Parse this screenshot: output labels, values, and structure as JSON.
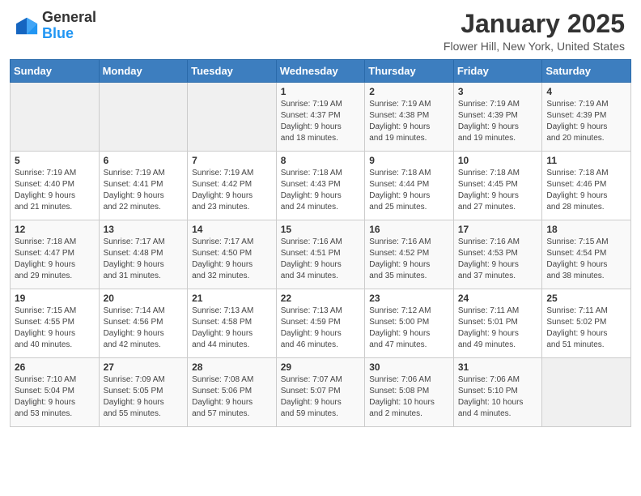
{
  "header": {
    "logo_general": "General",
    "logo_blue": "Blue",
    "title": "January 2025",
    "subtitle": "Flower Hill, New York, United States"
  },
  "weekdays": [
    "Sunday",
    "Monday",
    "Tuesday",
    "Wednesday",
    "Thursday",
    "Friday",
    "Saturday"
  ],
  "weeks": [
    [
      {
        "day": "",
        "info": ""
      },
      {
        "day": "",
        "info": ""
      },
      {
        "day": "",
        "info": ""
      },
      {
        "day": "1",
        "info": "Sunrise: 7:19 AM\nSunset: 4:37 PM\nDaylight: 9 hours\nand 18 minutes."
      },
      {
        "day": "2",
        "info": "Sunrise: 7:19 AM\nSunset: 4:38 PM\nDaylight: 9 hours\nand 19 minutes."
      },
      {
        "day": "3",
        "info": "Sunrise: 7:19 AM\nSunset: 4:39 PM\nDaylight: 9 hours\nand 19 minutes."
      },
      {
        "day": "4",
        "info": "Sunrise: 7:19 AM\nSunset: 4:39 PM\nDaylight: 9 hours\nand 20 minutes."
      }
    ],
    [
      {
        "day": "5",
        "info": "Sunrise: 7:19 AM\nSunset: 4:40 PM\nDaylight: 9 hours\nand 21 minutes."
      },
      {
        "day": "6",
        "info": "Sunrise: 7:19 AM\nSunset: 4:41 PM\nDaylight: 9 hours\nand 22 minutes."
      },
      {
        "day": "7",
        "info": "Sunrise: 7:19 AM\nSunset: 4:42 PM\nDaylight: 9 hours\nand 23 minutes."
      },
      {
        "day": "8",
        "info": "Sunrise: 7:18 AM\nSunset: 4:43 PM\nDaylight: 9 hours\nand 24 minutes."
      },
      {
        "day": "9",
        "info": "Sunrise: 7:18 AM\nSunset: 4:44 PM\nDaylight: 9 hours\nand 25 minutes."
      },
      {
        "day": "10",
        "info": "Sunrise: 7:18 AM\nSunset: 4:45 PM\nDaylight: 9 hours\nand 27 minutes."
      },
      {
        "day": "11",
        "info": "Sunrise: 7:18 AM\nSunset: 4:46 PM\nDaylight: 9 hours\nand 28 minutes."
      }
    ],
    [
      {
        "day": "12",
        "info": "Sunrise: 7:18 AM\nSunset: 4:47 PM\nDaylight: 9 hours\nand 29 minutes."
      },
      {
        "day": "13",
        "info": "Sunrise: 7:17 AM\nSunset: 4:48 PM\nDaylight: 9 hours\nand 31 minutes."
      },
      {
        "day": "14",
        "info": "Sunrise: 7:17 AM\nSunset: 4:50 PM\nDaylight: 9 hours\nand 32 minutes."
      },
      {
        "day": "15",
        "info": "Sunrise: 7:16 AM\nSunset: 4:51 PM\nDaylight: 9 hours\nand 34 minutes."
      },
      {
        "day": "16",
        "info": "Sunrise: 7:16 AM\nSunset: 4:52 PM\nDaylight: 9 hours\nand 35 minutes."
      },
      {
        "day": "17",
        "info": "Sunrise: 7:16 AM\nSunset: 4:53 PM\nDaylight: 9 hours\nand 37 minutes."
      },
      {
        "day": "18",
        "info": "Sunrise: 7:15 AM\nSunset: 4:54 PM\nDaylight: 9 hours\nand 38 minutes."
      }
    ],
    [
      {
        "day": "19",
        "info": "Sunrise: 7:15 AM\nSunset: 4:55 PM\nDaylight: 9 hours\nand 40 minutes."
      },
      {
        "day": "20",
        "info": "Sunrise: 7:14 AM\nSunset: 4:56 PM\nDaylight: 9 hours\nand 42 minutes."
      },
      {
        "day": "21",
        "info": "Sunrise: 7:13 AM\nSunset: 4:58 PM\nDaylight: 9 hours\nand 44 minutes."
      },
      {
        "day": "22",
        "info": "Sunrise: 7:13 AM\nSunset: 4:59 PM\nDaylight: 9 hours\nand 46 minutes."
      },
      {
        "day": "23",
        "info": "Sunrise: 7:12 AM\nSunset: 5:00 PM\nDaylight: 9 hours\nand 47 minutes."
      },
      {
        "day": "24",
        "info": "Sunrise: 7:11 AM\nSunset: 5:01 PM\nDaylight: 9 hours\nand 49 minutes."
      },
      {
        "day": "25",
        "info": "Sunrise: 7:11 AM\nSunset: 5:02 PM\nDaylight: 9 hours\nand 51 minutes."
      }
    ],
    [
      {
        "day": "26",
        "info": "Sunrise: 7:10 AM\nSunset: 5:04 PM\nDaylight: 9 hours\nand 53 minutes."
      },
      {
        "day": "27",
        "info": "Sunrise: 7:09 AM\nSunset: 5:05 PM\nDaylight: 9 hours\nand 55 minutes."
      },
      {
        "day": "28",
        "info": "Sunrise: 7:08 AM\nSunset: 5:06 PM\nDaylight: 9 hours\nand 57 minutes."
      },
      {
        "day": "29",
        "info": "Sunrise: 7:07 AM\nSunset: 5:07 PM\nDaylight: 9 hours\nand 59 minutes."
      },
      {
        "day": "30",
        "info": "Sunrise: 7:06 AM\nSunset: 5:08 PM\nDaylight: 10 hours\nand 2 minutes."
      },
      {
        "day": "31",
        "info": "Sunrise: 7:06 AM\nSunset: 5:10 PM\nDaylight: 10 hours\nand 4 minutes."
      },
      {
        "day": "",
        "info": ""
      }
    ]
  ]
}
